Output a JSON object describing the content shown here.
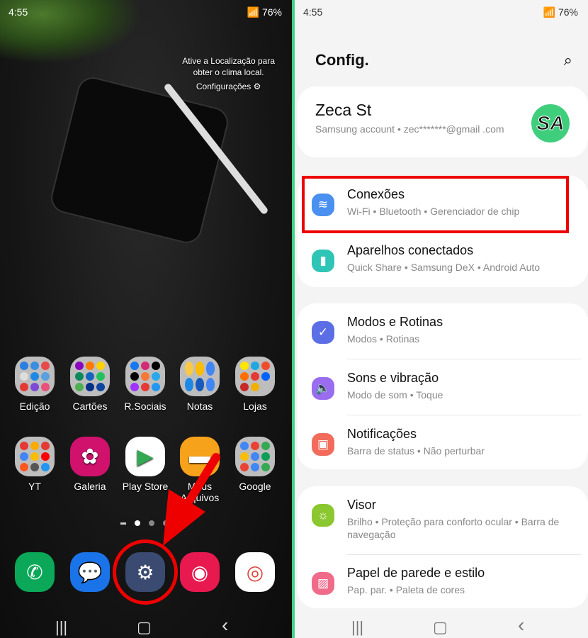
{
  "left": {
    "status": {
      "time": "4:55",
      "battery": "76%"
    },
    "weather": {
      "line1": "Ative a Localização para",
      "line2": "obter o clima local.",
      "settings": "Configurações ⚙"
    },
    "apps_row1": [
      {
        "label": "Edição"
      },
      {
        "label": "Cartões"
      },
      {
        "label": "R.Sociais"
      },
      {
        "label": "Notas"
      },
      {
        "label": "Lojas"
      }
    ],
    "apps_row2": [
      {
        "label": "YT"
      },
      {
        "label": "Galeria"
      },
      {
        "label": "Play Store"
      },
      {
        "label": "Meus Arquivos"
      },
      {
        "label": "Google"
      }
    ],
    "dock": [
      "phone-icon",
      "messages-icon",
      "settings-icon",
      "camera-icon",
      "chrome-icon"
    ],
    "nav": {
      "recents": "|||",
      "home": "▢",
      "back": "‹"
    }
  },
  "right": {
    "status": {
      "time": "4:55",
      "battery": "76%"
    },
    "title": "Config.",
    "account": {
      "name": "Zeca St",
      "sub": "Samsung account  •  zec*******@gmail .com",
      "avatar": "SA"
    },
    "groups": [
      [
        {
          "title": "Conexões",
          "sub": "Wi-Fi  •  Bluetooth  •  Gerenciador de chip",
          "color": "#4a90f0",
          "icon": "wifi-icon"
        },
        {
          "title": "Aparelhos conectados",
          "sub": "Quick Share  •  Samsung DeX  •  Android Auto",
          "color": "#2ec4b6",
          "icon": "devices-icon"
        }
      ],
      [
        {
          "title": "Modos e Rotinas",
          "sub": "Modos  •  Rotinas",
          "color": "#5b6ee6",
          "icon": "modes-icon"
        },
        {
          "title": "Sons e vibração",
          "sub": "Modo de som  •  Toque",
          "color": "#9a6cf0",
          "icon": "sound-icon"
        },
        {
          "title": "Notificações",
          "sub": "Barra de status  •  Não perturbar",
          "color": "#f26b5b",
          "icon": "notifications-icon"
        }
      ],
      [
        {
          "title": "Visor",
          "sub": "Brilho  •  Proteção para conforto ocular  •  Barra de navegação",
          "color": "#8bc72e",
          "icon": "display-icon"
        },
        {
          "title": "Papel de parede e estilo",
          "sub": "Pap. par.  •  Paleta de cores",
          "color": "#f06a8a",
          "icon": "wallpaper-icon"
        }
      ]
    ]
  },
  "annotation_color": "#e00000"
}
